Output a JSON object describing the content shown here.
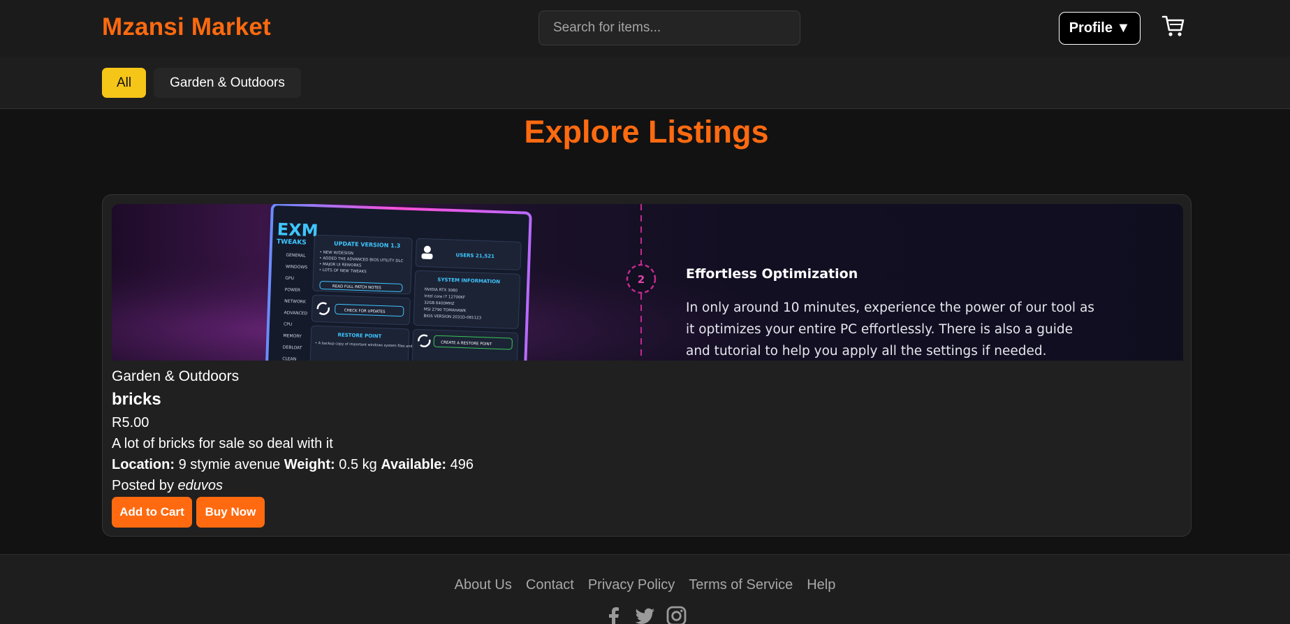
{
  "header": {
    "logo": "Mzansi Market",
    "search_placeholder": "Search for items...",
    "profile_label": "Profile ▼",
    "cart_icon": "cart-icon"
  },
  "categories": {
    "items": [
      {
        "label": "All",
        "active": true,
        "color": "#f5c518"
      },
      {
        "label": "Garden & Outdoors",
        "active": false
      }
    ]
  },
  "main": {
    "title": "Explore Listings"
  },
  "listing": {
    "banner": {
      "logo_top": "EXM",
      "logo_bottom": "TWEAKS",
      "update_header": "UPDATE VERSION 1.3",
      "update_lines": [
        "• NEW W/DESIGN",
        "• ADDED THE ADVANCED BIOS UTILITY DLC",
        "• MAJOR UI REWORKS",
        "• LOTS OF NEW TWEAKS"
      ],
      "patch_button": "READ FULL PATCH NOTES",
      "check_button": "CHECK FOR UPDATES",
      "restore_header": "RESTORE POINT",
      "restore_text": "• A backup copy of important windows system files and settings that can be used to recover the",
      "restore_button": "CREATE A RESTORE POINT",
      "users": "USERS 21,521",
      "sysinfo_header": "SYSTEM INFORMATION",
      "sysinfo_lines": [
        "NVIDIA RTX 3080",
        "Intel core i7 12700KF",
        "32GB 6400MHZ",
        "MSI Z790 TOMAHAWK",
        "BIOS VERSION 2031D-081123"
      ],
      "nav_items": [
        "GENERAL",
        "WINDOWS",
        "GPU",
        "POWER",
        "NETWORK",
        "ADVANCED",
        "CPU",
        "MEMORY",
        "DEBLOAT",
        "CLEAN"
      ],
      "step_number": "2",
      "heading": "Effortless Optimization",
      "body": "In only around 10 minutes, experience the power of our tool as it optimizes your entire PC effortlessly. There is also a guide and tutorial to help you apply all the settings if needed."
    },
    "category": "Garden & Outdoors",
    "title": "bricks",
    "price": "R5.00",
    "description": "A lot of bricks for sale so deal with it",
    "location_label": "Location:",
    "location": "9 stymie avenue",
    "weight_label": "Weight:",
    "weight": "0.5 kg",
    "available_label": "Available:",
    "available": "496",
    "posted_by_label": "Posted by",
    "posted_by": "eduvos",
    "add_to_cart": "Add to Cart",
    "buy_now": "Buy Now"
  },
  "footer": {
    "links": [
      "About Us",
      "Contact",
      "Privacy Policy",
      "Terms of Service",
      "Help"
    ],
    "social_icons": [
      "facebook-icon",
      "twitter-icon",
      "instagram-icon"
    ]
  },
  "colors": {
    "accent": "#ff6a10",
    "active_chip": "#f5c518",
    "background": "#121212"
  }
}
